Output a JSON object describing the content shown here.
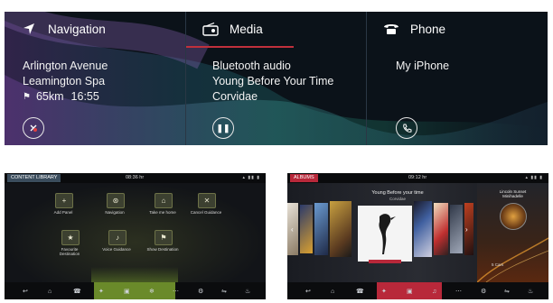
{
  "top_screen": {
    "panels": [
      {
        "id": "navigation",
        "title": "Navigation",
        "icon": "navigation-arrow-icon",
        "lines": [
          "Arlington Avenue",
          "Leamington Spa"
        ],
        "distance": "65km",
        "time": "16:55",
        "button_icon": "cancel-route-icon"
      },
      {
        "id": "media",
        "title": "Media",
        "icon": "radio-icon",
        "lines": [
          "Bluetooth audio",
          "Young Before Your Time",
          "Corvidae"
        ],
        "progress": 0.6,
        "button_icon": "pause-icon"
      },
      {
        "id": "phone",
        "title": "Phone",
        "icon": "phone-icon",
        "lines": [
          "My iPhone"
        ],
        "button_icon": "call-icon"
      }
    ],
    "accent_color": "#c0303c"
  },
  "content_library": {
    "label": "CONTENT LIBRARY",
    "label_color": "#3a4c5c",
    "clock": "08:36 hr",
    "tiles": [
      {
        "label": "Add Panel",
        "glyph": "+"
      },
      {
        "label": "Navigation",
        "glyph": "⊛"
      },
      {
        "label": "Take me home",
        "glyph": "⌂"
      },
      {
        "label": "Cancel Guidance",
        "glyph": "✕"
      },
      {
        "label": "Favourite Destination",
        "glyph": "★"
      },
      {
        "label": "Voice Guidance",
        "glyph": "♪"
      },
      {
        "label": "Show Destination",
        "glyph": "⚑"
      }
    ],
    "bottom_icons": [
      "↩",
      "⌂",
      "☎",
      "✦",
      "▣",
      "❄",
      "⋯",
      "⚙",
      "⇋",
      "♨"
    ],
    "active_color": "#6a8a2a"
  },
  "albums": {
    "label": "ALBUMS",
    "label_color": "#b8283a",
    "clock": "09:12 hr",
    "current_title": "Young Before your time",
    "current_artist": "Corvidae",
    "side_title": "Lincoln Sunset",
    "side_subtitle": "Minihadelle",
    "side_info": "5 Cars",
    "bottom_icons": [
      "↩",
      "⌂",
      "☎",
      "✦",
      "▣",
      "♫",
      "⋯",
      "⚙",
      "⇋",
      "♨"
    ],
    "active_color": "#b8283a"
  }
}
